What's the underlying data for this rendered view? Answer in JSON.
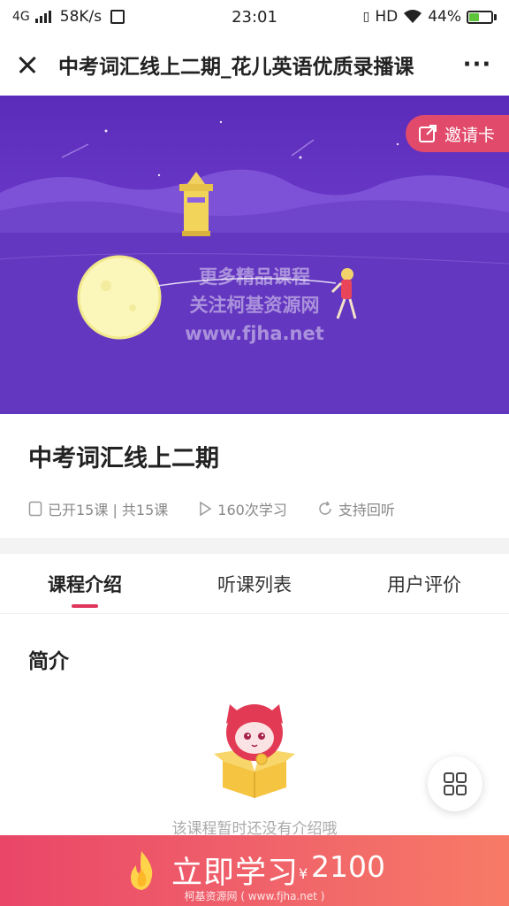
{
  "status_bar": {
    "network": "4G",
    "speed": "58K/s",
    "time": "23:01",
    "hd": "HD",
    "battery": "44%",
    "battery_level": 0.44
  },
  "nav": {
    "title": "中考词汇线上二期_花儿英语优质录播课"
  },
  "banner": {
    "invite_label": "邀请卡",
    "watermark_line1": "更多精品课程",
    "watermark_line2": "关注柯基资源网",
    "watermark_line3": "www.fjha.net"
  },
  "course": {
    "title": "中考词汇线上二期",
    "lessons": "已开15课 | 共15课",
    "views": "160次学习",
    "replay": "支持回听"
  },
  "tabs": [
    {
      "label": "课程介绍",
      "active": true
    },
    {
      "label": "听课列表",
      "active": false
    },
    {
      "label": "用户评价",
      "active": false
    }
  ],
  "intro": {
    "title": "简介",
    "empty_text": "该课程暂时还没有介绍哦"
  },
  "bottom": {
    "action_label": "立即学习",
    "currency": "¥",
    "price": "2100",
    "watermark": "柯基资源网 ( www.fjha.net )"
  },
  "colors": {
    "accent": "#e0355a",
    "banner": "#6a38c8",
    "invite": "#e24a6b"
  }
}
